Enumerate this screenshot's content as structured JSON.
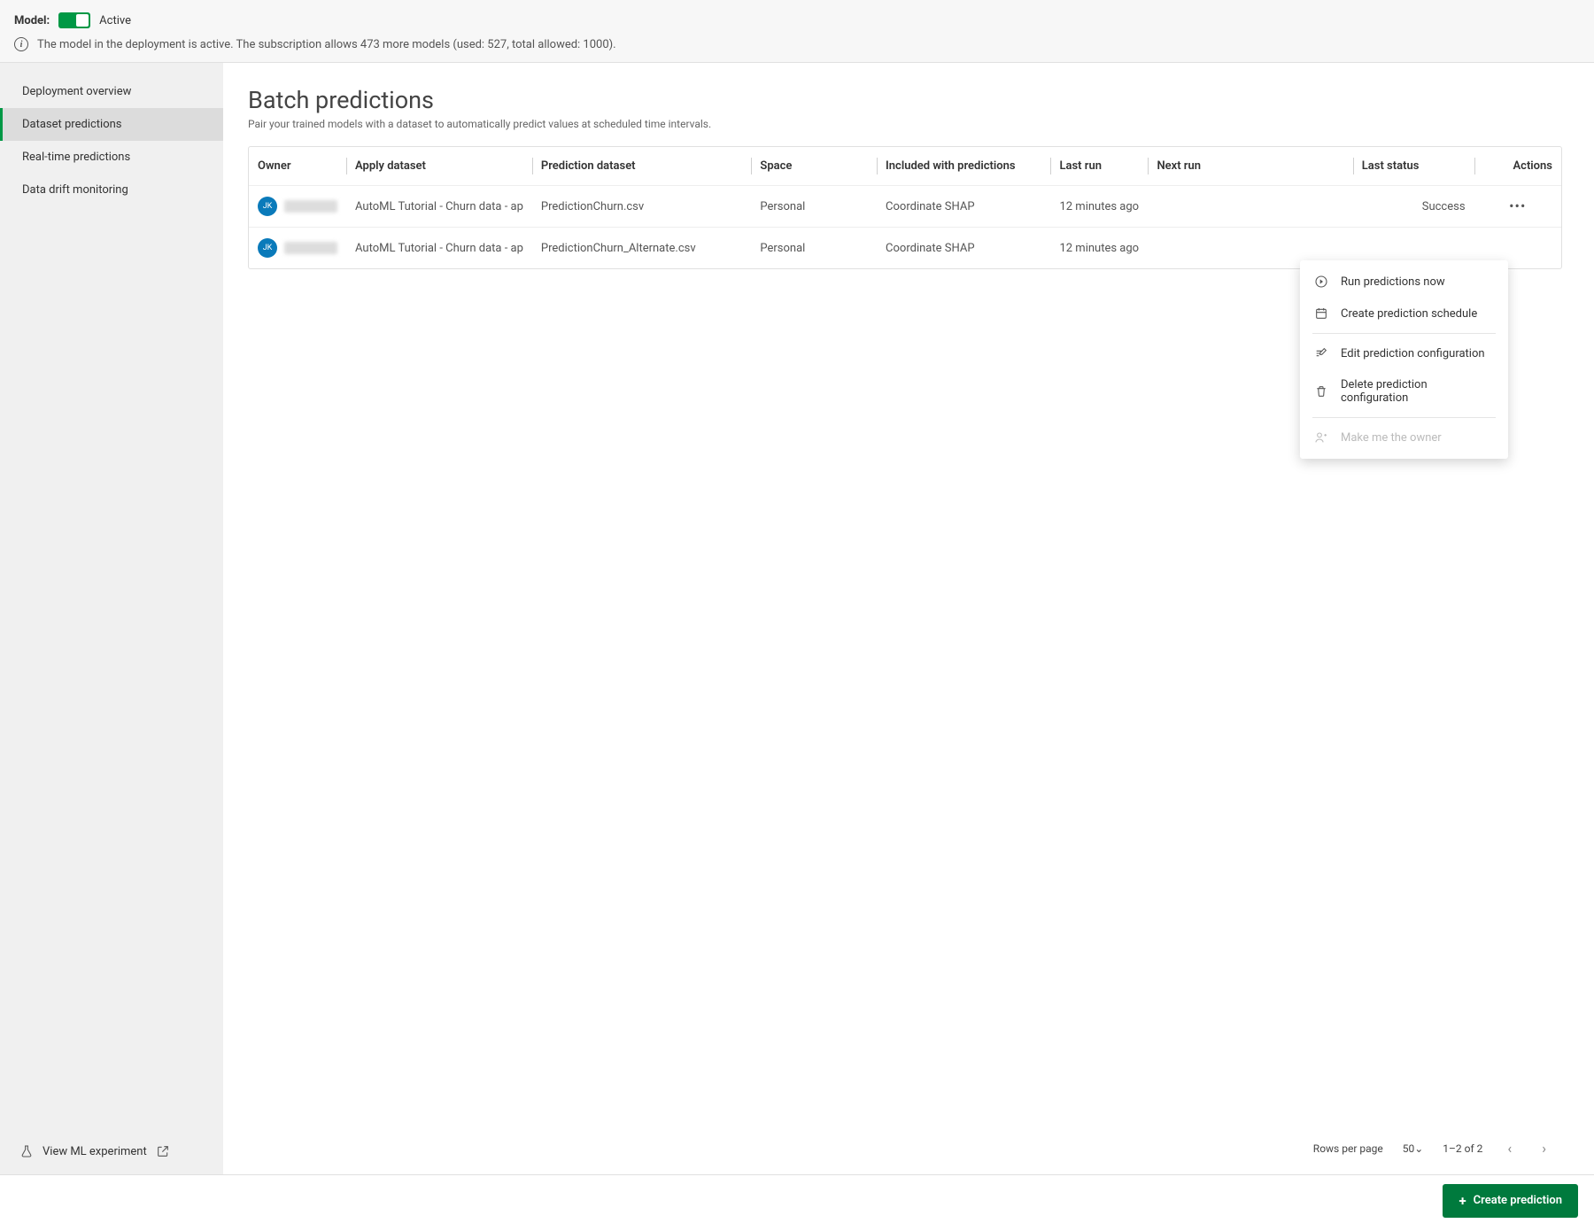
{
  "header": {
    "model_label": "Model:",
    "status": "Active",
    "info_text": "The model in the deployment is active. The subscription allows 473 more models (used: 527, total allowed: 1000)."
  },
  "sidebar": {
    "items": [
      {
        "label": "Deployment overview",
        "active": false
      },
      {
        "label": "Dataset predictions",
        "active": true
      },
      {
        "label": "Real-time predictions",
        "active": false
      },
      {
        "label": "Data drift monitoring",
        "active": false
      }
    ],
    "footer_label": "View ML experiment"
  },
  "page": {
    "title": "Batch predictions",
    "subtitle": "Pair your trained models with a dataset to automatically predict values at scheduled time intervals."
  },
  "table": {
    "columns": [
      "Owner",
      "Apply dataset",
      "Prediction dataset",
      "Space",
      "Included with predictions",
      "Last run",
      "Next run",
      "Last status",
      "Actions"
    ],
    "rows": [
      {
        "owner_initials": "JK",
        "apply_dataset": "AutoML Tutorial - Churn data - ap",
        "prediction_dataset": "PredictionChurn.csv",
        "space": "Personal",
        "included": "Coordinate SHAP",
        "last_run": "12 minutes ago",
        "next_run": "",
        "last_status": "Success"
      },
      {
        "owner_initials": "JK",
        "apply_dataset": "AutoML Tutorial - Churn data - ap",
        "prediction_dataset": "PredictionChurn_Alternate.csv",
        "space": "Personal",
        "included": "Coordinate SHAP",
        "last_run": "12 minutes ago",
        "next_run": "",
        "last_status": ""
      }
    ]
  },
  "context_menu": {
    "run_now": "Run predictions now",
    "schedule": "Create prediction schedule",
    "edit": "Edit prediction configuration",
    "delete": "Delete prediction configuration",
    "make_owner": "Make me the owner"
  },
  "pagination": {
    "rows_per_page_label": "Rows per page",
    "rows_per_page_value": "50",
    "range": "1–2 of 2"
  },
  "footer": {
    "create_button": "Create prediction"
  }
}
